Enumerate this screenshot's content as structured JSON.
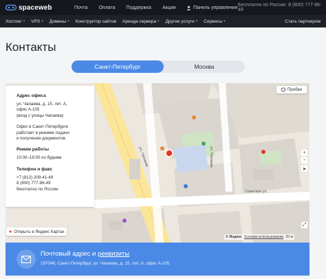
{
  "header": {
    "logo_text": "spaceweb",
    "nav": [
      "Почта",
      "Оплата",
      "Поддержка",
      "Акции"
    ],
    "control_panel": "Панель управления",
    "free_call": "Бесплатно по России: 8 (800) 777-86-49"
  },
  "subnav": {
    "items": [
      {
        "label": "Хостинг",
        "dropdown": true
      },
      {
        "label": "VPS",
        "dropdown": true
      },
      {
        "label": "Домены",
        "dropdown": true
      },
      {
        "label": "Конструктор сайтов",
        "dropdown": false
      },
      {
        "label": "Аренда сервера",
        "dropdown": true
      },
      {
        "label": "Другие услуги",
        "dropdown": true
      },
      {
        "label": "Сервисы",
        "dropdown": true
      }
    ],
    "partner": "Стать партнером"
  },
  "page": {
    "title": "Контакты",
    "cities": [
      {
        "label": "Санкт-Петербург",
        "active": true
      },
      {
        "label": "Москва",
        "active": false
      }
    ]
  },
  "office": {
    "address_heading": "Адрес офиса",
    "address_lines": [
      "ул. Чапаева, д. 15, лит. А,",
      "офис А-105",
      "(вход с улицы Чапаева)"
    ],
    "note_lines": [
      "Офис в Санкт-Петербурге",
      "работает в режиме подачи",
      "и получения документов."
    ],
    "hours_heading": "Режим работы",
    "hours": "10:00–19:00 по будням",
    "phone_heading": "Телефон и факс",
    "phone_local": "+7 (812) 209-41-49",
    "phone_free": "8 (800) 777-86-49",
    "phone_free_note": "бесплатно по России"
  },
  "map": {
    "open_link": "Открыть в Яндекс Картах",
    "traffic": "Пробки",
    "attribution_brand": "© Яндекс",
    "attribution_terms": "Условия использования",
    "scale": "20 м",
    "street_labels": [
      "ул. Чапаева",
      "Гранская ул.",
      "ул. Чапаева"
    ],
    "accent_color": "#4b89e6"
  },
  "mail": {
    "title_prefix": "Почтовый адрес и",
    "title_link": "реквизиты",
    "address": "197046, Санкт-Петербург, ул. Чапаева, д. 15, лит. А, офис А-105"
  }
}
